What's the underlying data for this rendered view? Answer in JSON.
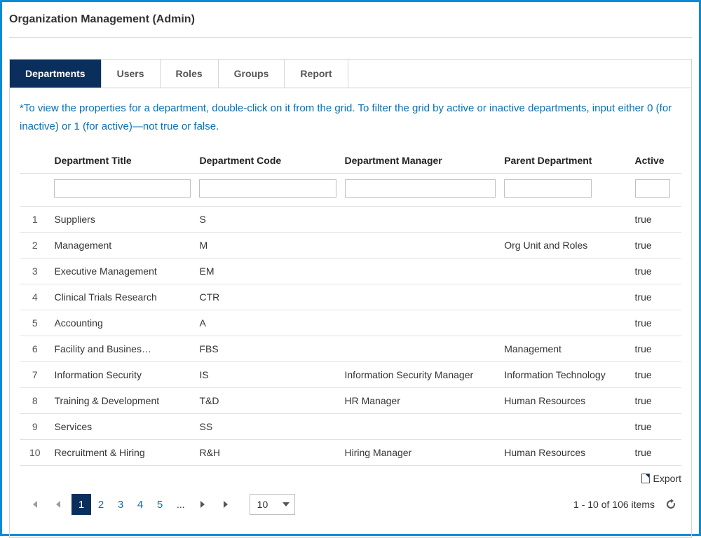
{
  "header": {
    "title": "Organization Management (Admin)"
  },
  "tabs": [
    {
      "label": "Departments",
      "active": true
    },
    {
      "label": "Users",
      "active": false
    },
    {
      "label": "Roles",
      "active": false
    },
    {
      "label": "Groups",
      "active": false
    },
    {
      "label": "Report",
      "active": false
    }
  ],
  "hint": "*To view the properties for a department, double-click on it from the grid. To filter the grid by active or inactive departments, input either 0 (for inactive) or 1 (for active)—not true or false.",
  "grid": {
    "columns": {
      "title": "Department Title",
      "code": "Department Code",
      "manager": "Department Manager",
      "parent": "Parent Department",
      "active": "Active"
    },
    "filters": {
      "title": "",
      "code": "",
      "manager": "",
      "parent": "",
      "active": ""
    },
    "rows": [
      {
        "idx": "1",
        "title": "Suppliers",
        "code": "S",
        "manager": "",
        "parent": "",
        "active": "true"
      },
      {
        "idx": "2",
        "title": "Management",
        "code": "M",
        "manager": "",
        "parent": "Org Unit and Roles",
        "active": "true"
      },
      {
        "idx": "3",
        "title": "Executive Management",
        "code": "EM",
        "manager": "",
        "parent": "",
        "active": "true"
      },
      {
        "idx": "4",
        "title": "Clinical Trials Research",
        "code": "CTR",
        "manager": "",
        "parent": "",
        "active": "true"
      },
      {
        "idx": "5",
        "title": "Accounting",
        "code": "A",
        "manager": "",
        "parent": "",
        "active": "true"
      },
      {
        "idx": "6",
        "title": "Facility and Busines…",
        "code": "FBS",
        "manager": "",
        "parent": "Management",
        "active": "true"
      },
      {
        "idx": "7",
        "title": "Information Security",
        "code": "IS",
        "manager": "Information Security Manager",
        "parent": "Information Technology",
        "active": "true"
      },
      {
        "idx": "8",
        "title": "Training & Development",
        "code": "T&D",
        "manager": "HR Manager",
        "parent": "Human Resources",
        "active": "true"
      },
      {
        "idx": "9",
        "title": "Services",
        "code": "SS",
        "manager": "",
        "parent": "",
        "active": "true"
      },
      {
        "idx": "10",
        "title": "Recruitment & Hiring",
        "code": "R&H",
        "manager": "Hiring Manager",
        "parent": "Human Resources",
        "active": "true"
      }
    ]
  },
  "toolbar": {
    "export_label": "Export"
  },
  "pager": {
    "pages": [
      "1",
      "2",
      "3",
      "4",
      "5"
    ],
    "ellipsis": "...",
    "current": "1",
    "page_size": "10",
    "summary": "1 - 10 of 106 items"
  }
}
